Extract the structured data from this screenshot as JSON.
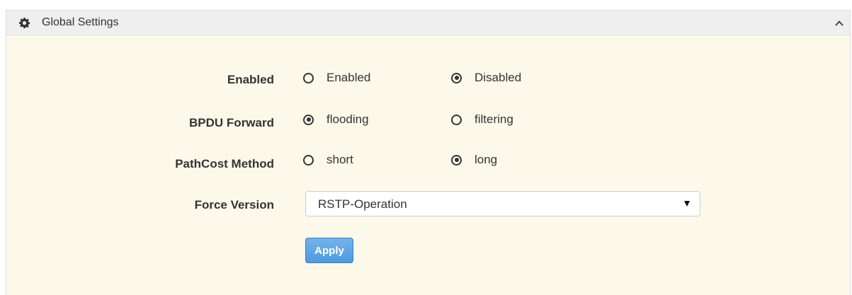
{
  "panel": {
    "title": "Global Settings",
    "header_icon": "gear-icon",
    "collapse_icon": "chevron-up-icon"
  },
  "form": {
    "enabled": {
      "label": "Enabled",
      "options": [
        "Enabled",
        "Disabled"
      ],
      "selected": "Disabled"
    },
    "bpdu_forward": {
      "label": "BPDU Forward",
      "options": [
        "flooding",
        "filtering"
      ],
      "selected": "flooding"
    },
    "pathcost_method": {
      "label": "PathCost Method",
      "options": [
        "short",
        "long"
      ],
      "selected": "long"
    },
    "force_version": {
      "label": "Force Version",
      "selected_value": "RSTP-Operation"
    },
    "apply_label": "Apply"
  },
  "colors": {
    "panel_body": "#fdf9ea",
    "header_bg": "#efefef",
    "button_primary": "#5ba0e4",
    "text": "#333333"
  }
}
